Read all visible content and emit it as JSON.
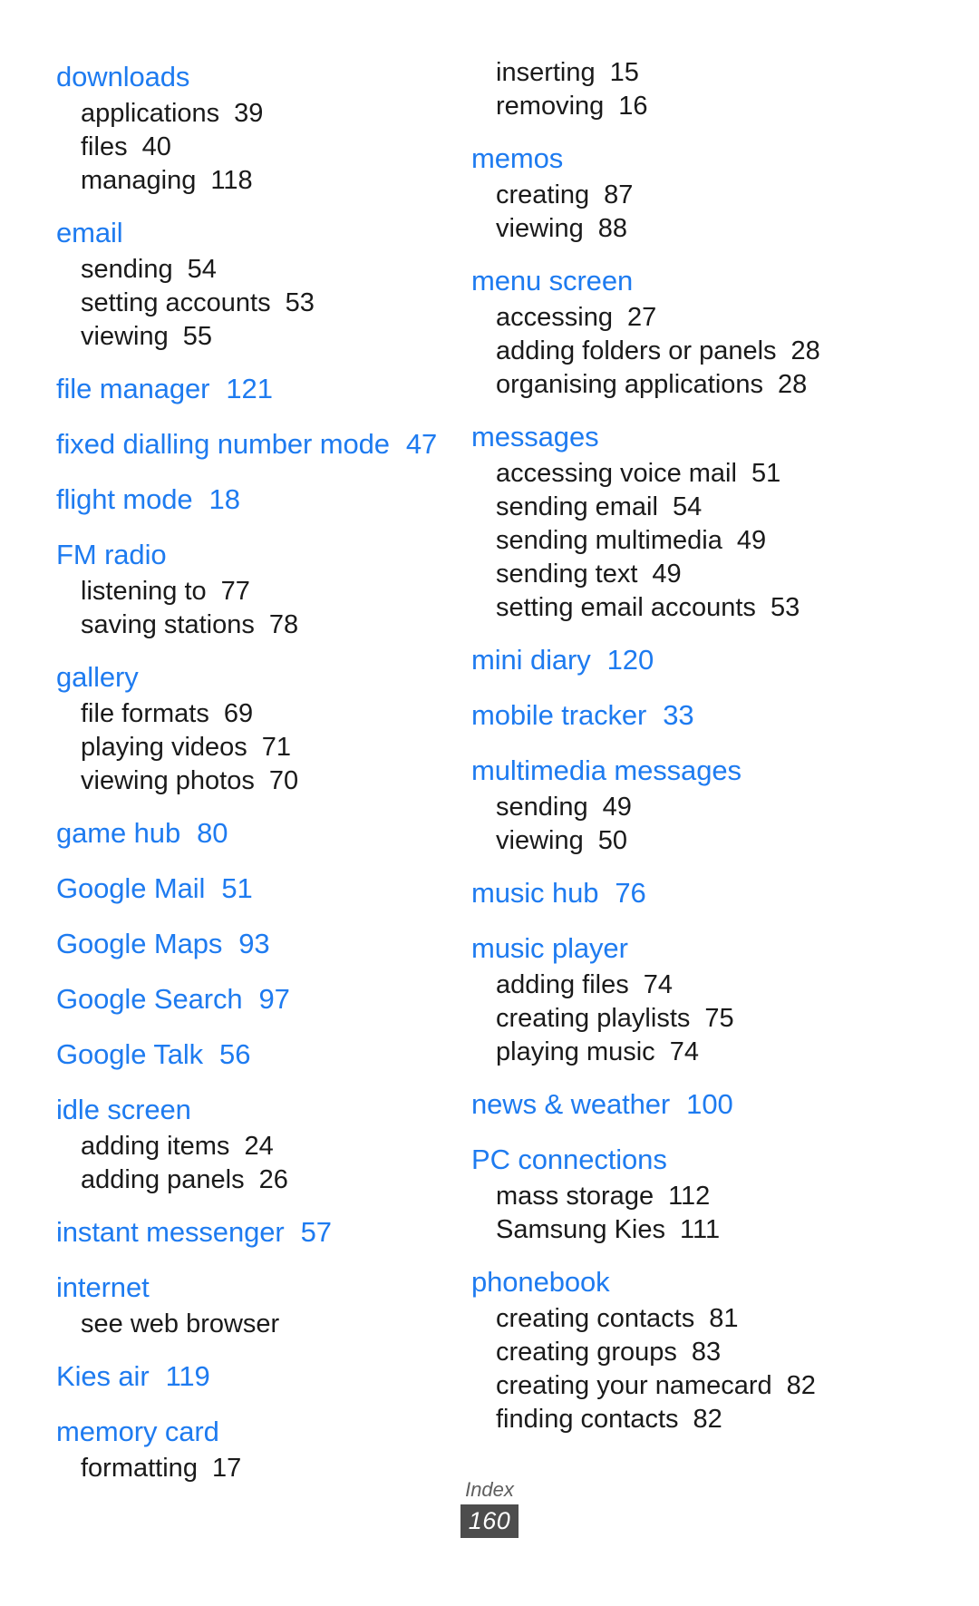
{
  "document": {
    "kind": "index-page",
    "footer_label": "Index",
    "page_number": "160",
    "heading_color": "#1e7bf0",
    "body_color": "#1a1a1a",
    "page_badge_bg": "#4d4d4d"
  },
  "columns": [
    {
      "id": "left",
      "groups": [
        {
          "title": "downloads",
          "page": "",
          "subs": [
            {
              "label": "applications",
              "page": "39"
            },
            {
              "label": "files",
              "page": "40"
            },
            {
              "label": "managing",
              "page": "118"
            }
          ]
        },
        {
          "title": "email",
          "page": "",
          "subs": [
            {
              "label": "sending",
              "page": "54"
            },
            {
              "label": "setting accounts",
              "page": "53"
            },
            {
              "label": "viewing",
              "page": "55"
            }
          ]
        },
        {
          "title": "file manager",
          "page": "121",
          "subs": []
        },
        {
          "title": "fixed dialling number mode",
          "page": "47",
          "subs": []
        },
        {
          "title": "flight mode",
          "page": "18",
          "subs": []
        },
        {
          "title": "FM radio",
          "page": "",
          "subs": [
            {
              "label": "listening to",
              "page": "77"
            },
            {
              "label": "saving stations",
              "page": "78"
            }
          ]
        },
        {
          "title": "gallery",
          "page": "",
          "subs": [
            {
              "label": "file formats",
              "page": "69"
            },
            {
              "label": "playing videos",
              "page": "71"
            },
            {
              "label": "viewing photos",
              "page": "70"
            }
          ]
        },
        {
          "title": "game hub",
          "page": "80",
          "subs": []
        },
        {
          "title": "Google Mail",
          "page": "51",
          "subs": []
        },
        {
          "title": "Google Maps",
          "page": "93",
          "subs": []
        },
        {
          "title": "Google Search",
          "page": "97",
          "subs": []
        },
        {
          "title": "Google Talk",
          "page": "56",
          "subs": []
        },
        {
          "title": "idle screen",
          "page": "",
          "subs": [
            {
              "label": "adding items",
              "page": "24"
            },
            {
              "label": "adding panels",
              "page": "26"
            }
          ]
        },
        {
          "title": "instant messenger",
          "page": "57",
          "subs": []
        },
        {
          "title": "internet",
          "page": "",
          "subs": [
            {
              "label": "see web browser",
              "page": ""
            }
          ]
        },
        {
          "title": "Kies air",
          "page": "119",
          "subs": []
        },
        {
          "title": "memory card",
          "page": "",
          "subs": [
            {
              "label": "formatting",
              "page": "17"
            }
          ]
        }
      ]
    },
    {
      "id": "right",
      "continued_subs": [
        {
          "label": "inserting",
          "page": "15"
        },
        {
          "label": "removing",
          "page": "16"
        }
      ],
      "groups": [
        {
          "title": "memos",
          "page": "",
          "subs": [
            {
              "label": "creating",
              "page": "87"
            },
            {
              "label": "viewing",
              "page": "88"
            }
          ]
        },
        {
          "title": "menu screen",
          "page": "",
          "subs": [
            {
              "label": "accessing",
              "page": "27"
            },
            {
              "label": "adding folders or panels",
              "page": "28"
            },
            {
              "label": "organising applications",
              "page": "28"
            }
          ]
        },
        {
          "title": "messages",
          "page": "",
          "subs": [
            {
              "label": "accessing voice mail",
              "page": "51"
            },
            {
              "label": "sending email",
              "page": "54"
            },
            {
              "label": "sending multimedia",
              "page": "49"
            },
            {
              "label": "sending text",
              "page": "49"
            },
            {
              "label": "setting email accounts",
              "page": "53"
            }
          ]
        },
        {
          "title": "mini diary",
          "page": "120",
          "subs": []
        },
        {
          "title": "mobile tracker",
          "page": "33",
          "subs": []
        },
        {
          "title": "multimedia messages",
          "page": "",
          "subs": [
            {
              "label": "sending",
              "page": "49"
            },
            {
              "label": "viewing",
              "page": "50"
            }
          ]
        },
        {
          "title": "music hub",
          "page": "76",
          "subs": []
        },
        {
          "title": "music player",
          "page": "",
          "subs": [
            {
              "label": "adding files",
              "page": "74"
            },
            {
              "label": "creating playlists",
              "page": "75"
            },
            {
              "label": "playing music",
              "page": "74"
            }
          ]
        },
        {
          "title": "news & weather",
          "page": "100",
          "subs": []
        },
        {
          "title": "PC connections",
          "page": "",
          "subs": [
            {
              "label": "mass storage",
              "page": "112"
            },
            {
              "label": "Samsung Kies",
              "page": "111"
            }
          ]
        },
        {
          "title": "phonebook",
          "page": "",
          "subs": [
            {
              "label": "creating contacts",
              "page": "81"
            },
            {
              "label": "creating groups",
              "page": "83"
            },
            {
              "label": "creating your namecard",
              "page": "82"
            },
            {
              "label": "finding contacts",
              "page": "82"
            }
          ]
        }
      ]
    }
  ]
}
